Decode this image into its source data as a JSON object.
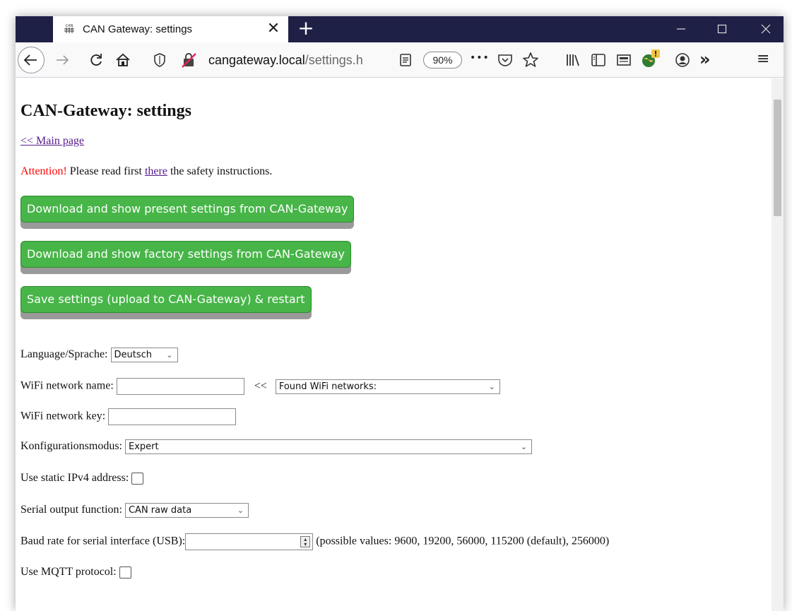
{
  "browser": {
    "tab_title": "CAN Gateway: settings",
    "tab_close": "✕",
    "new_tab": "+",
    "url_host": "cangateway.local",
    "url_path": "/settings.h",
    "zoom": "90%",
    "more": "•••",
    "overflow": "»",
    "menu": "≡"
  },
  "page": {
    "title": "CAN-Gateway: settings",
    "main_link": "<< Main page",
    "attention_label": "Attention!",
    "attention_pre": " Please read first ",
    "attention_link": "there",
    "attention_post": " the safety instructions.",
    "buttons": {
      "download_present": "Download and show present settings from CAN-Gateway",
      "download_factory": "Download and show factory settings from CAN-Gateway",
      "save_restart": "Save settings (upload to CAN-Gateway) & restart"
    },
    "language": {
      "label": "Language/Sprache:",
      "value": "Deutsch"
    },
    "wifi_name": {
      "label": "WiFi network name:",
      "value": "",
      "arrow": "<<",
      "found_select": "Found WiFi networks:"
    },
    "wifi_key": {
      "label": "WiFi network key:",
      "value": ""
    },
    "config_mode": {
      "label": "Konfigurationsmodus:",
      "value": "Expert"
    },
    "static_ip": {
      "label": "Use static IPv4 address:",
      "checked": false
    },
    "serial_output": {
      "label": "Serial output function:",
      "value": "CAN raw data"
    },
    "baud_rate": {
      "label": "Baud rate for serial interface (USB):",
      "value": "",
      "hint": "(possible values: 9600, 19200, 56000, 115200 (default), 256000)"
    },
    "mqtt": {
      "label": "Use MQTT protocol:",
      "checked": false
    }
  }
}
